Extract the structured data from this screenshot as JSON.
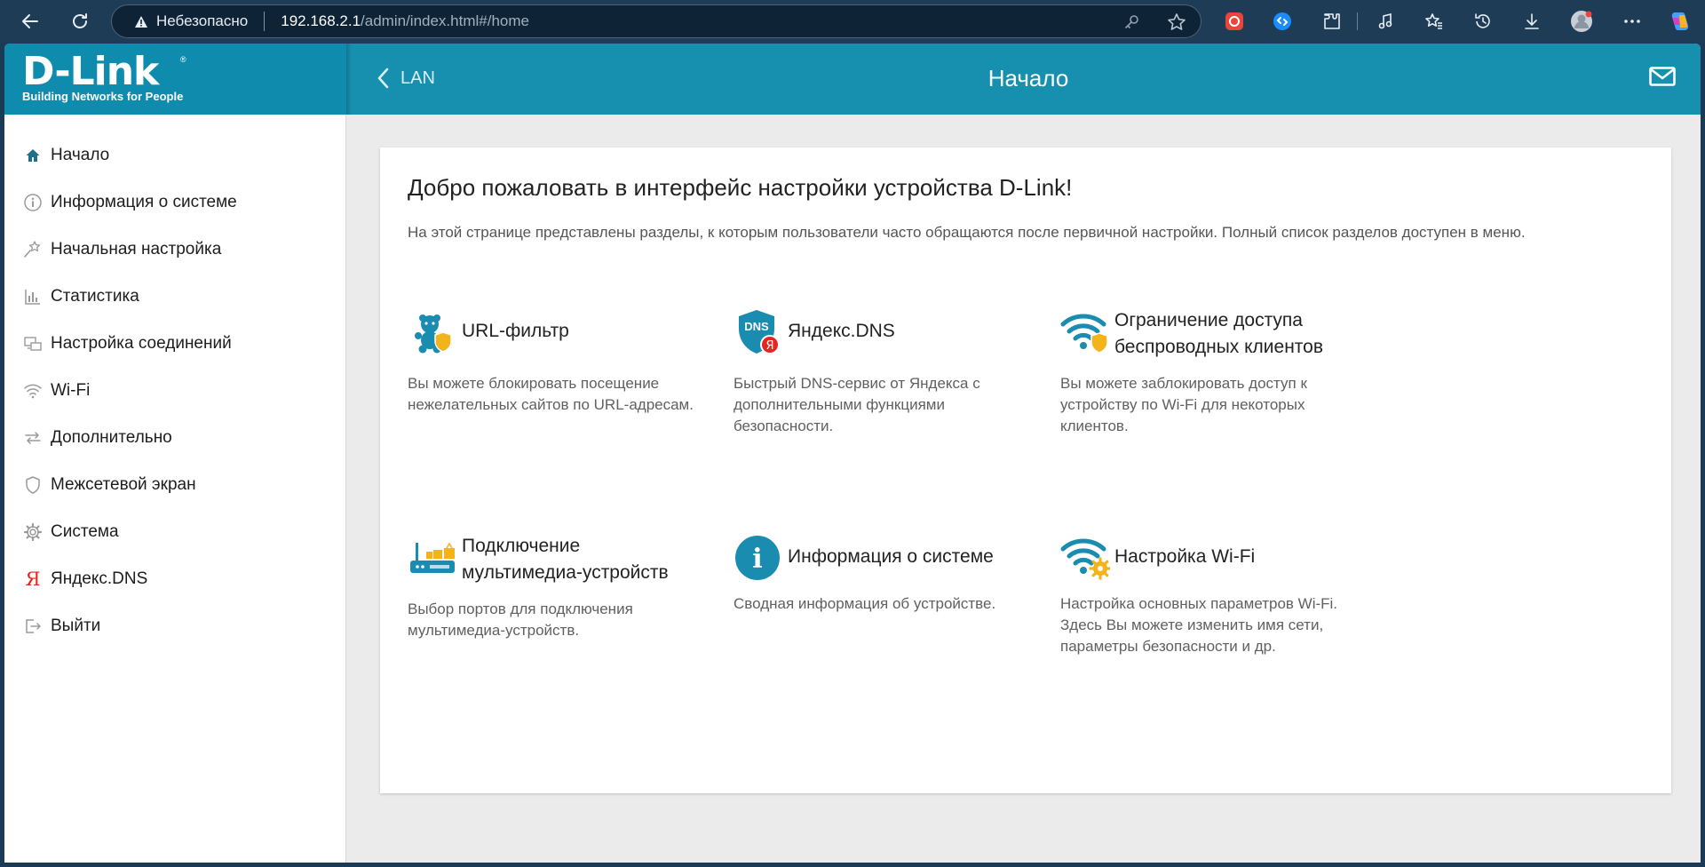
{
  "browser": {
    "insecure_label": "Небезопасно",
    "url_host": "192.168.2.1",
    "url_path": "/admin/index.html#/home"
  },
  "header": {
    "logo_text": "D-Link",
    "logo_tagline": "Building Networks for People",
    "back_label": "LAN",
    "title": "Начало"
  },
  "sidebar": {
    "items": [
      {
        "label": "Начало",
        "icon": "home-icon"
      },
      {
        "label": "Информация о системе",
        "icon": "info-icon"
      },
      {
        "label": "Начальная настройка",
        "icon": "wizard-icon"
      },
      {
        "label": "Статистика",
        "icon": "statistics-icon"
      },
      {
        "label": "Настройка соединений",
        "icon": "connections-icon"
      },
      {
        "label": "Wi-Fi",
        "icon": "wifi-icon"
      },
      {
        "label": "Дополнительно",
        "icon": "advanced-icon"
      },
      {
        "label": "Межсетевой экран",
        "icon": "shield-icon"
      },
      {
        "label": "Система",
        "icon": "gear-icon"
      },
      {
        "label": "Яндекс.DNS",
        "icon": "yandex-icon"
      },
      {
        "label": "Выйти",
        "icon": "logout-icon"
      }
    ]
  },
  "main": {
    "welcome": "Добро пожаловать в интерфейс настройки устройства D-Link!",
    "intro": "На этой странице представлены разделы, к которым пользователи часто обращаются после первичной настройки. Полный список разделов доступен в меню.",
    "tiles": [
      {
        "title": "URL-фильтр",
        "desc": "Вы можете блокировать посещение нежелательных сайтов по URL-адресам.",
        "icon": "url-filter-icon"
      },
      {
        "title": "Яндекс.DNS",
        "desc": "Быстрый DNS-сервис от Яндекса с дополнительными функциями безопасности.",
        "icon": "yandex-dns-icon",
        "icon_text": "DNS",
        "badge_text": "Я"
      },
      {
        "title": "Ограничение доступа беспроводных клиентов",
        "desc": "Вы можете заблокировать доступ к устройству по Wi-Fi для некоторых клиентов.",
        "icon": "wifi-shield-icon"
      },
      {
        "title": "Подключение мультимедиа-устройств",
        "desc": "Выбор портов для подключения мультимедиа-устройств.",
        "icon": "multimedia-icon"
      },
      {
        "title": "Информация о системе",
        "desc": "Сводная информация об устройстве.",
        "icon": "system-info-icon",
        "icon_text": "i"
      },
      {
        "title": "Настройка Wi-Fi",
        "desc": "Настройка основных параметров Wi-Fi. Здесь Вы можете изменить имя сети, параметры безопасности и др.",
        "icon": "wifi-settings-icon"
      }
    ]
  },
  "colors": {
    "header": "#1790b0",
    "accent": "#1a8cb0",
    "shield": "#f2b31b"
  }
}
